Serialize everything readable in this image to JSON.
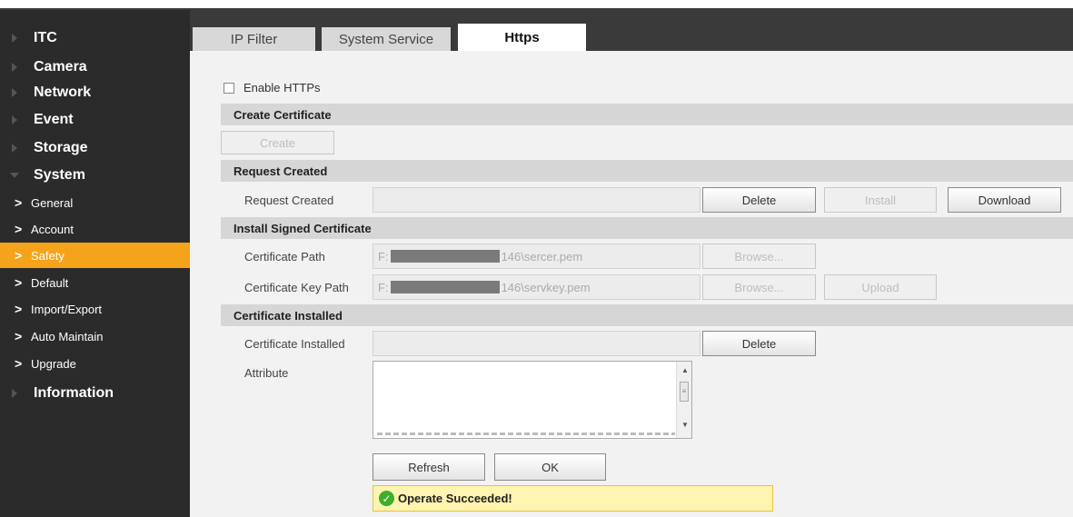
{
  "sidebar": {
    "top": [
      "ITC",
      "Camera",
      "Network",
      "Event",
      "Storage",
      "System"
    ],
    "sub": [
      "General",
      "Account",
      "Safety",
      "Default",
      "Import/Export",
      "Auto Maintain",
      "Upgrade"
    ],
    "bottom": "Information",
    "active_sub": "Safety"
  },
  "tabs": [
    "IP Filter",
    "System Service",
    "Https"
  ],
  "active_tab": "Https",
  "enable_https": {
    "label": "Enable HTTPs",
    "checked": false
  },
  "sections": {
    "create_certificate": "Create Certificate",
    "request_created": "Request Created",
    "install_signed": "Install Signed Certificate",
    "certificate_installed": "Certificate Installed"
  },
  "buttons": {
    "create": "Create",
    "delete": "Delete",
    "install": "Install",
    "download": "Download",
    "browse": "Browse...",
    "upload": "Upload",
    "refresh": "Refresh",
    "ok": "OK"
  },
  "fields": {
    "request_created_label": "Request Created",
    "certificate_path_label": "Certificate Path",
    "certificate_path_prefix": "F:",
    "certificate_path_suffix": "146\\sercer.pem",
    "certificate_key_path_label": "Certificate Key Path",
    "certificate_key_path_prefix": "F:",
    "certificate_key_path_suffix": "146\\servkey.pem",
    "certificate_installed_label": "Certificate Installed",
    "attribute_label": "Attribute"
  },
  "status_message": "Operate Succeeded!",
  "colors": {
    "accent": "#f5a31a",
    "sidebar": "#2b2b2b",
    "success": "#3fae2a"
  }
}
